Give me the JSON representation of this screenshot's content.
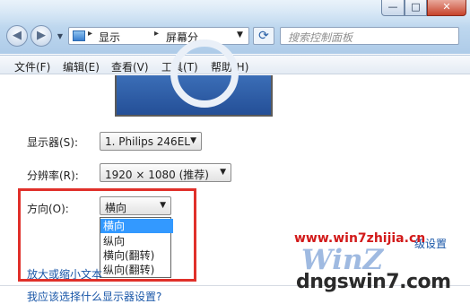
{
  "window": {
    "minimize": "—",
    "maximize": "□",
    "close": "✕"
  },
  "nav": {
    "back_icon": "arrow-left-icon",
    "forward_icon": "arrow-right-icon",
    "back_glyph": "◀",
    "forward_glyph": "▶",
    "history_glyph": "▼"
  },
  "address": {
    "breadcrumbs": [
      "显示",
      "屏幕分..."
    ],
    "separator": "▸",
    "dropdown_glyph": "▼",
    "refresh_glyph": "⟳"
  },
  "search": {
    "placeholder": "搜索控制面板"
  },
  "menu": {
    "items": [
      "文件(F)",
      "编辑(E)",
      "查看(V)",
      "工具(T)",
      "帮助(H)"
    ]
  },
  "settings": {
    "display_label": "显示器(S):",
    "display_value": "1. Philips 246EL",
    "resolution_label": "分辨率(R):",
    "resolution_value": "1920 × 1080 (推荐)",
    "orientation_label": "方向(O):",
    "orientation_value": "横向",
    "orientation_options": [
      "横向",
      "纵向",
      "横向(翻转)",
      "纵向(翻转)"
    ],
    "orientation_selected_index": 0,
    "combo_arrow": "▼"
  },
  "links": {
    "text_size": "放大或缩小文本",
    "advanced": "级设置",
    "which_display": "我应该选择什么显示器设置?"
  },
  "watermark": {
    "url": "www.win7zhijia.cn",
    "logo": "WinZ",
    "domain": "dngswin7.com"
  },
  "colors": {
    "highlight_border": "#e0302a",
    "selection": "#3399ff",
    "link": "#1a57a8",
    "watermark_red": "#d21a1a"
  }
}
